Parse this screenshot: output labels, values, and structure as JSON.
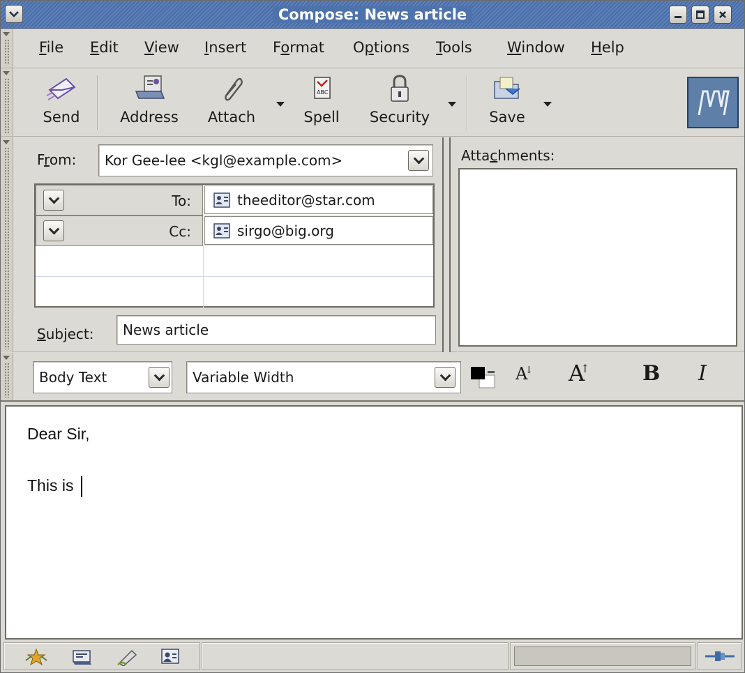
{
  "window": {
    "title": "Compose: News article",
    "controls": [
      "minimize-icon",
      "maximize-icon",
      "close-icon"
    ]
  },
  "menubar": {
    "items": [
      {
        "id": "file",
        "pre": "",
        "key": "F",
        "post": "ile"
      },
      {
        "id": "edit",
        "pre": "",
        "key": "E",
        "post": "dit"
      },
      {
        "id": "view",
        "pre": "",
        "key": "V",
        "post": "iew"
      },
      {
        "id": "insert",
        "pre": "",
        "key": "I",
        "post": "nsert"
      },
      {
        "id": "format",
        "pre": "F",
        "key": "o",
        "post": "rmat"
      },
      {
        "id": "options",
        "pre": "O",
        "key": "p",
        "post": "tions"
      },
      {
        "id": "tools",
        "pre": "",
        "key": "T",
        "post": "ools"
      },
      {
        "id": "window",
        "pre": "",
        "key": "W",
        "post": "indow"
      },
      {
        "id": "help",
        "pre": "",
        "key": "H",
        "post": "elp"
      }
    ]
  },
  "toolbar": {
    "send": "Send",
    "address": "Address",
    "attach": "Attach",
    "spell": "Spell",
    "security": "Security",
    "save": "Save"
  },
  "compose": {
    "from_label_pre": "F",
    "from_label_key": "r",
    "from_label_post": "om:",
    "from_value": "Kor Gee-lee <kgl@example.com>",
    "recipients": [
      {
        "type": "To:",
        "address": "theeditor@star.com"
      },
      {
        "type": "Cc:",
        "address": "sirgo@big.org"
      }
    ],
    "subject_label_key": "S",
    "subject_label_post": "ubject:",
    "subject_value": "News article",
    "attachments_label_pre": "Atta",
    "attachments_label_key": "c",
    "attachments_label_post": "hments:"
  },
  "formatbar": {
    "paragraph_style": "Body Text",
    "font": "Variable Width",
    "bold": "B",
    "italic": "I",
    "smaller": "A",
    "larger": "A"
  },
  "body": {
    "line1": "Dear Sir,",
    "line2": "This is "
  },
  "colors": {
    "titlebar": "#4a6ea8",
    "chrome": "#dcdad5",
    "logo_bg": "#5d7fa8"
  }
}
